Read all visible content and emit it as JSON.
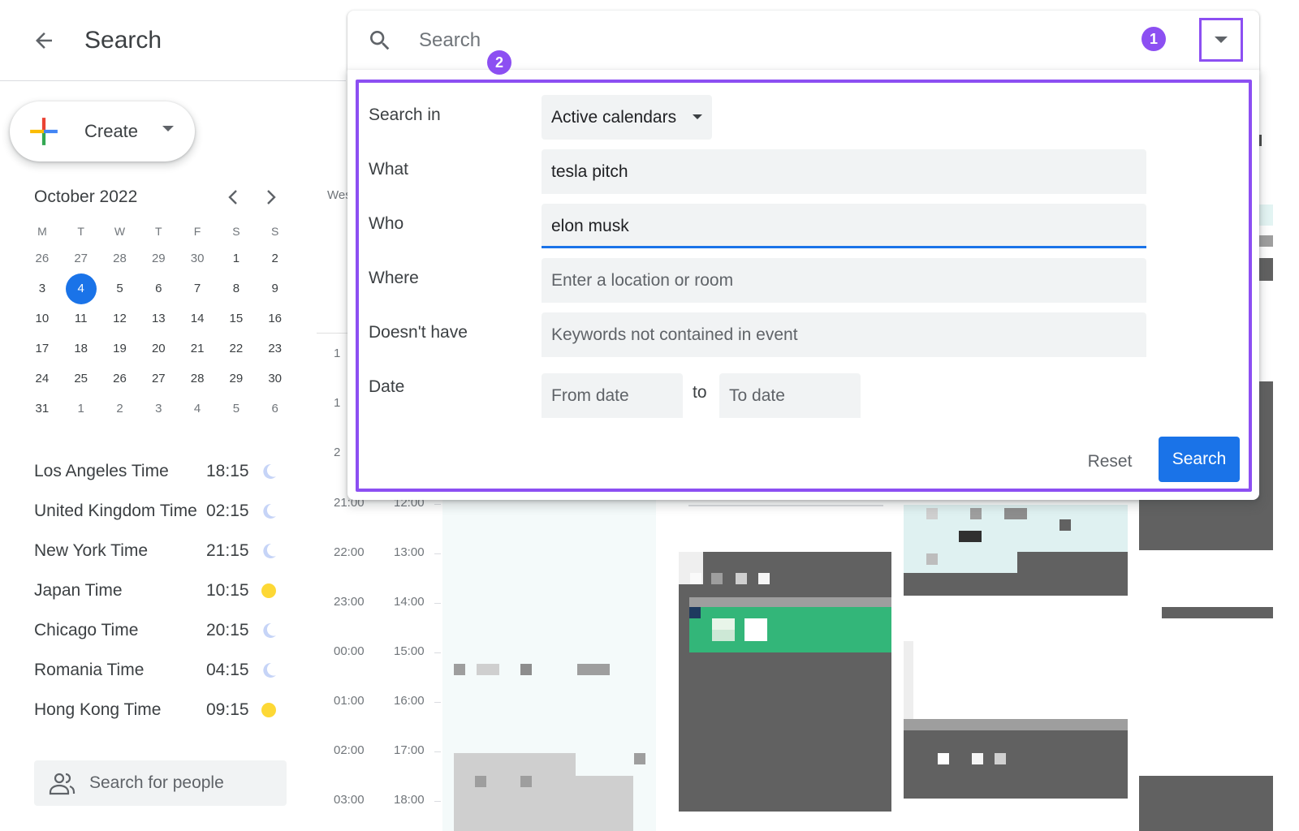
{
  "header": {
    "title": "Search"
  },
  "create": {
    "label": "Create"
  },
  "mini_calendar": {
    "month": "October 2022",
    "weekdays": [
      "M",
      "T",
      "W",
      "T",
      "F",
      "S",
      "S"
    ],
    "weeks": [
      [
        "26",
        "27",
        "28",
        "29",
        "30",
        "1",
        "2"
      ],
      [
        "3",
        "4",
        "5",
        "6",
        "7",
        "8",
        "9"
      ],
      [
        "10",
        "11",
        "12",
        "13",
        "14",
        "15",
        "16"
      ],
      [
        "17",
        "18",
        "19",
        "20",
        "21",
        "22",
        "23"
      ],
      [
        "24",
        "25",
        "26",
        "27",
        "28",
        "29",
        "30"
      ],
      [
        "31",
        "1",
        "2",
        "3",
        "4",
        "5",
        "6"
      ]
    ],
    "today": "4"
  },
  "world_clock": [
    {
      "name": "Los Angeles Time",
      "time": "18:15",
      "icon": "moon-icon"
    },
    {
      "name": "United Kingdom Time",
      "time": "02:15",
      "icon": "moon-icon"
    },
    {
      "name": "New York Time",
      "time": "21:15",
      "icon": "moon-icon"
    },
    {
      "name": "Japan Time",
      "time": "10:15",
      "icon": "sun-icon"
    },
    {
      "name": "Chicago Time",
      "time": "20:15",
      "icon": "moon-icon"
    },
    {
      "name": "Romania Time",
      "time": "04:15",
      "icon": "moon-icon"
    },
    {
      "name": "Hong Kong Time",
      "time": "09:15",
      "icon": "sun-icon"
    }
  ],
  "people_search": {
    "placeholder": "Search for people"
  },
  "background_calendar": {
    "week_label": "Wes",
    "hours_left": [
      "21:00",
      "22:00",
      "23:00",
      "00:00",
      "01:00",
      "02:00",
      "03:00"
    ],
    "hours_right": [
      "12:00",
      "13:00",
      "14:00",
      "15:00",
      "16:00",
      "17:00",
      "18:00"
    ],
    "partial_hours": [
      "1",
      "1",
      "2"
    ]
  },
  "search_bar": {
    "placeholder": "Search"
  },
  "badges": {
    "one": "1",
    "two": "2"
  },
  "advanced_search": {
    "search_in": {
      "label": "Search in",
      "value": "Active calendars"
    },
    "what": {
      "label": "What",
      "value": "tesla pitch"
    },
    "who": {
      "label": "Who",
      "value": "elon musk"
    },
    "where": {
      "label": "Where",
      "placeholder": "Enter a location or room"
    },
    "doesnt_have": {
      "label": "Doesn't have",
      "placeholder": "Keywords not contained in event"
    },
    "date": {
      "label": "Date",
      "from_placeholder": "From date",
      "to_label": "to",
      "to_placeholder": "To date"
    },
    "reset_label": "Reset",
    "search_label": "Search"
  },
  "colors": {
    "accent_purple": "#8c4ff2",
    "primary_blue": "#1a73e8",
    "event_dark": "#616161",
    "event_green": "#33b679"
  }
}
